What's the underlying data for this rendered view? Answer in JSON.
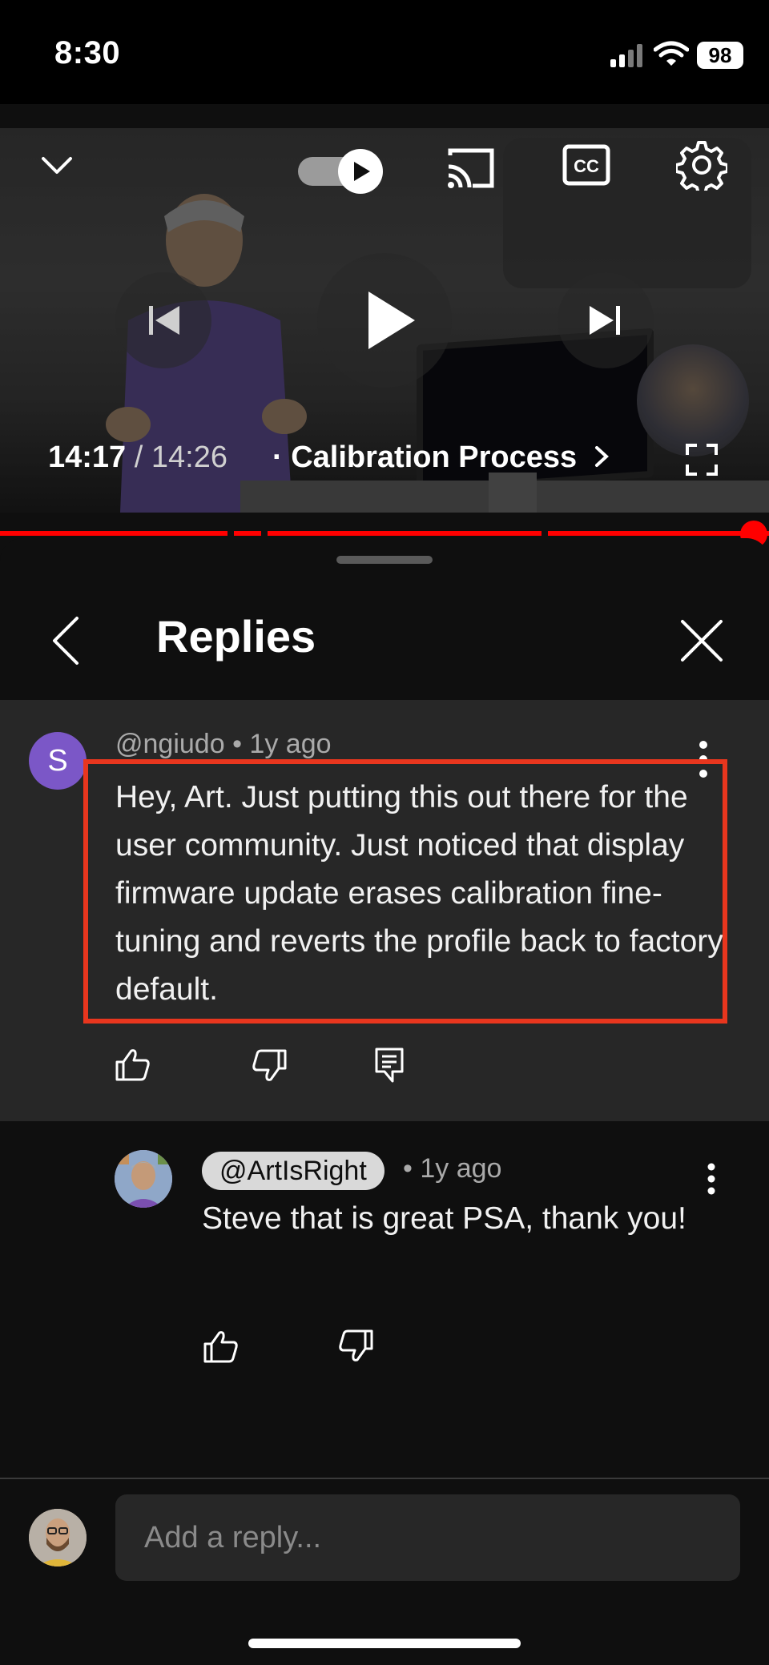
{
  "status_bar": {
    "time": "8:30",
    "battery": "98",
    "icons": [
      "signal-icon",
      "wifi-icon",
      "battery-icon"
    ]
  },
  "video": {
    "current_time": "14:17",
    "separator": " / ",
    "duration": "14:26",
    "chapter_title": "· Calibration Process",
    "progress_fraction": 0.99,
    "icons": [
      "chevron-down-icon",
      "autoplay-toggle-icon",
      "cast-icon",
      "cc-icon",
      "settings-icon",
      "previous-icon",
      "play-icon",
      "next-icon",
      "fullscreen-icon",
      "chapter-chevron-icon"
    ]
  },
  "replies_panel": {
    "title": "Replies",
    "icons": [
      "back-icon",
      "close-icon"
    ]
  },
  "parent_comment": {
    "avatar_letter": "S",
    "author": "@ngiudo",
    "time": "• 1y ago",
    "text": "Hey, Art. Just putting this out there for the user community. Just noticed that display firmware update erases calibration fine-tuning and reverts the profile back to factory default.",
    "highlight_color": "#e8361e",
    "icons": [
      "more-vert-icon",
      "like-icon",
      "dislike-icon",
      "reply-icon"
    ]
  },
  "reply": {
    "author": "@ArtIsRight",
    "time": "• 1y ago",
    "text": "Steve that is great PSA, thank you!",
    "icons": [
      "more-vert-icon",
      "like-icon",
      "dislike-icon"
    ]
  },
  "add_reply": {
    "placeholder": "Add a reply..."
  },
  "colors": {
    "background": "#0f0f0f",
    "comment_background": "#272727",
    "progress": "#ff0000",
    "avatar_purple": "#7b57c7"
  }
}
